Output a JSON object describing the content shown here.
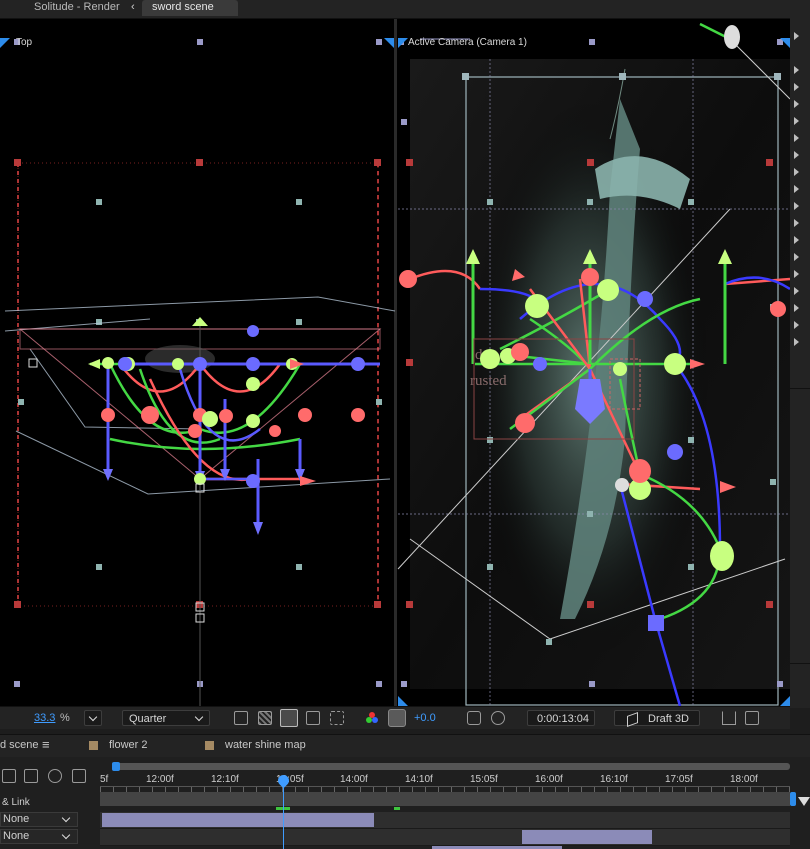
{
  "header": {
    "app_tab_label": "Solitude - Render",
    "active_tab_label": "sword scene",
    "back_chevron": "‹"
  },
  "viewports": {
    "left_label": "Top",
    "right_label": "Active Camera (Camera 1)"
  },
  "viewer_bar": {
    "zoom_value": "33.3",
    "zoom_unit": "%",
    "resolution": "Quarter",
    "exposure": "+0.0",
    "timecode": "0:00:13:04",
    "renderer": "Draft 3D"
  },
  "timeline": {
    "tabs": [
      {
        "label": "d scene"
      },
      {
        "label": "flower 2"
      },
      {
        "label": "water shine map"
      }
    ],
    "menu_icon": "≡",
    "ruler_labels": [
      "5f",
      "12:00f",
      "12:10f",
      "13:05f",
      "14:00f",
      "14:10f",
      "15:05f",
      "16:00f",
      "16:10f",
      "17:05f",
      "18:00f"
    ],
    "parent_header": "& Link",
    "rows": [
      {
        "parent": "None"
      },
      {
        "parent": "None"
      }
    ]
  },
  "colors": {
    "accent_blue": "#2d8ceb",
    "gizmo_red": "#ff6b6b",
    "gizmo_green": "#3ec43e",
    "gizmo_blue": "#5a5aff",
    "gizmo_lime": "#c8ff80",
    "timecode_blue": "#3f9cff"
  }
}
